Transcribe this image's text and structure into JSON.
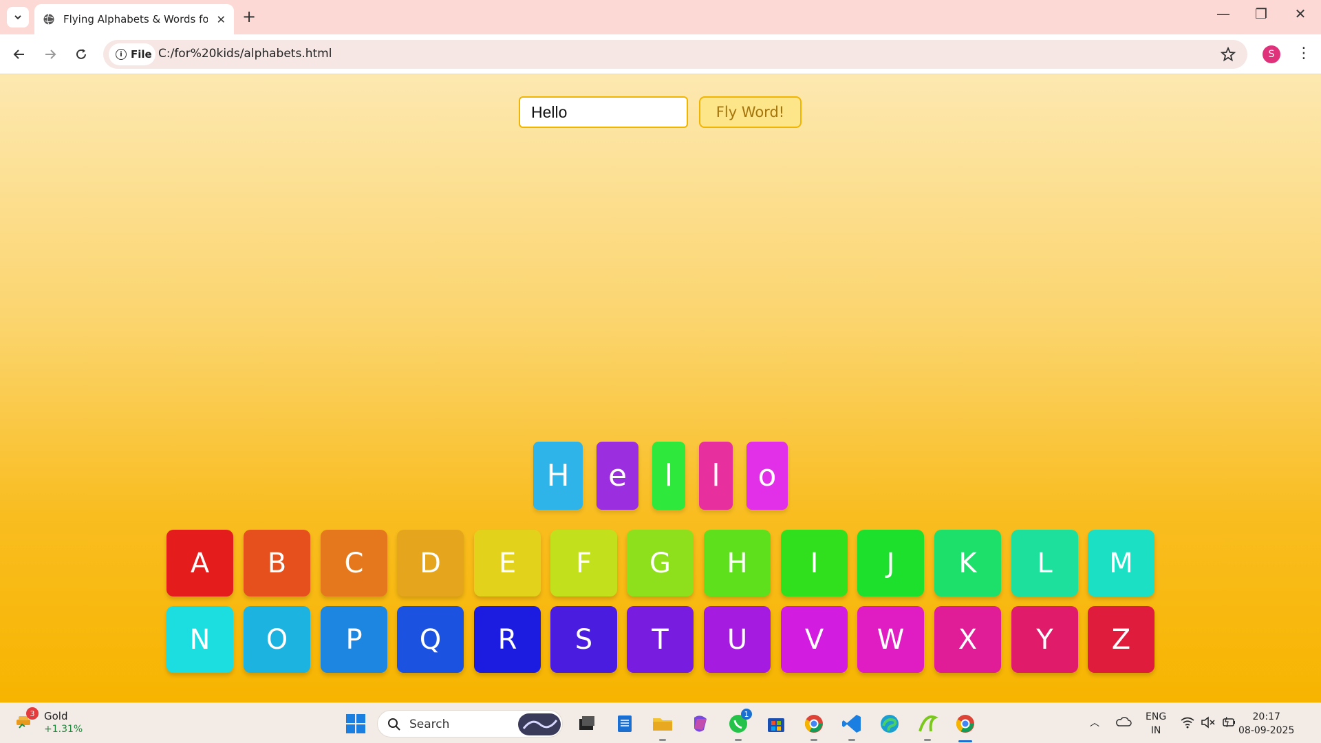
{
  "browser": {
    "tab_title": "Flying Alphabets & Words for K",
    "new_tab_label": "+",
    "site_chip": "File",
    "url": "C:/for%20kids/alphabets.html",
    "profile_initial": "S"
  },
  "app": {
    "input_value": "Hello",
    "fly_button_label": "Fly Word!",
    "flying_letters": [
      {
        "char": "H",
        "color": "#2eb4e8"
      },
      {
        "char": "e",
        "color": "#9b2fe0"
      },
      {
        "char": "l",
        "color": "#2fe83c"
      },
      {
        "char": "l",
        "color": "#e82f9e"
      },
      {
        "char": "o",
        "color": "#e22fe8"
      }
    ],
    "keys_row1": [
      {
        "char": "A",
        "color": "#e41c1c"
      },
      {
        "char": "B",
        "color": "#e5501c"
      },
      {
        "char": "C",
        "color": "#e5781c"
      },
      {
        "char": "D",
        "color": "#e5a51c"
      },
      {
        "char": "E",
        "color": "#e3d21c"
      },
      {
        "char": "F",
        "color": "#c3e01c"
      },
      {
        "char": "G",
        "color": "#8fe01c"
      },
      {
        "char": "H",
        "color": "#5ee01c"
      },
      {
        "char": "I",
        "color": "#30e01c"
      },
      {
        "char": "J",
        "color": "#1ce02c"
      },
      {
        "char": "K",
        "color": "#1ce06a"
      },
      {
        "char": "L",
        "color": "#1ce09b"
      },
      {
        "char": "M",
        "color": "#1ce0c3"
      }
    ],
    "keys_row2": [
      {
        "char": "N",
        "color": "#1cdde0"
      },
      {
        "char": "O",
        "color": "#1cb3e0"
      },
      {
        "char": "P",
        "color": "#1c86e0"
      },
      {
        "char": "Q",
        "color": "#1c52e0"
      },
      {
        "char": "R",
        "color": "#1c1ce0"
      },
      {
        "char": "S",
        "color": "#4a1ce0"
      },
      {
        "char": "T",
        "color": "#781ce0"
      },
      {
        "char": "U",
        "color": "#a51ce0"
      },
      {
        "char": "V",
        "color": "#d21ce0"
      },
      {
        "char": "W",
        "color": "#e01cc3"
      },
      {
        "char": "X",
        "color": "#e01c96"
      },
      {
        "char": "Y",
        "color": "#e01c6a"
      },
      {
        "char": "Z",
        "color": "#e01c3c"
      }
    ]
  },
  "taskbar": {
    "widget_badge": "3",
    "widget_name": "Gold",
    "widget_change": "+1.31%",
    "search_label": "Search",
    "whatsapp_badge": "1",
    "lang_line1": "ENG",
    "lang_line2": "IN",
    "time": "20:17",
    "date": "08-09-2025"
  }
}
